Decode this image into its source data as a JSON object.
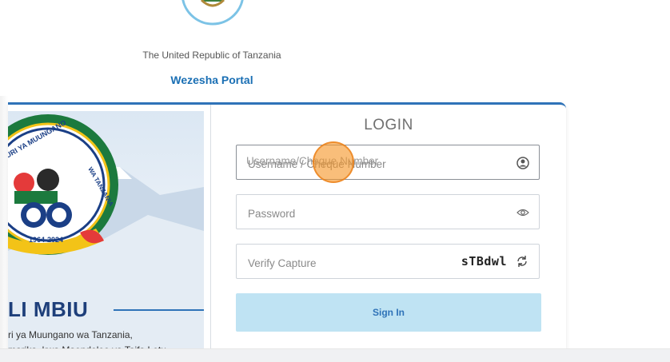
{
  "header": {
    "country": "The United Republic of Tanzania",
    "portal_name": "Wezesha Portal",
    "emblem_icon": "tanzania-coat-of-arms-icon"
  },
  "banner": {
    "logo": "muungano-60-years-logo",
    "logo_text": "JAMHURI YA MUUNGANO WA TANZANIA",
    "logo_years": "1964-2024",
    "title": "LI MBIU",
    "line1": "ri ya Muungano wa Tanzania,",
    "line2": "marika, kwa Maendeleo ya Taifa Letu"
  },
  "login": {
    "title": "LOGIN",
    "username_label": "Username/Cheque Number",
    "username_placeholder": "Username / Cheque Number",
    "password_placeholder": "Password",
    "captcha_placeholder": "Verify Capture",
    "captcha_code": "sTBdwl",
    "sign_in_label": "Sign In",
    "user_icon": "user-circle-icon",
    "eye_icon": "eye-icon",
    "refresh_icon": "refresh-icon"
  },
  "colors": {
    "accent": "#2f73b8",
    "button_bg": "#bfe3f3",
    "title_blue": "#1e3f7a",
    "cursor": "#f5962a"
  }
}
